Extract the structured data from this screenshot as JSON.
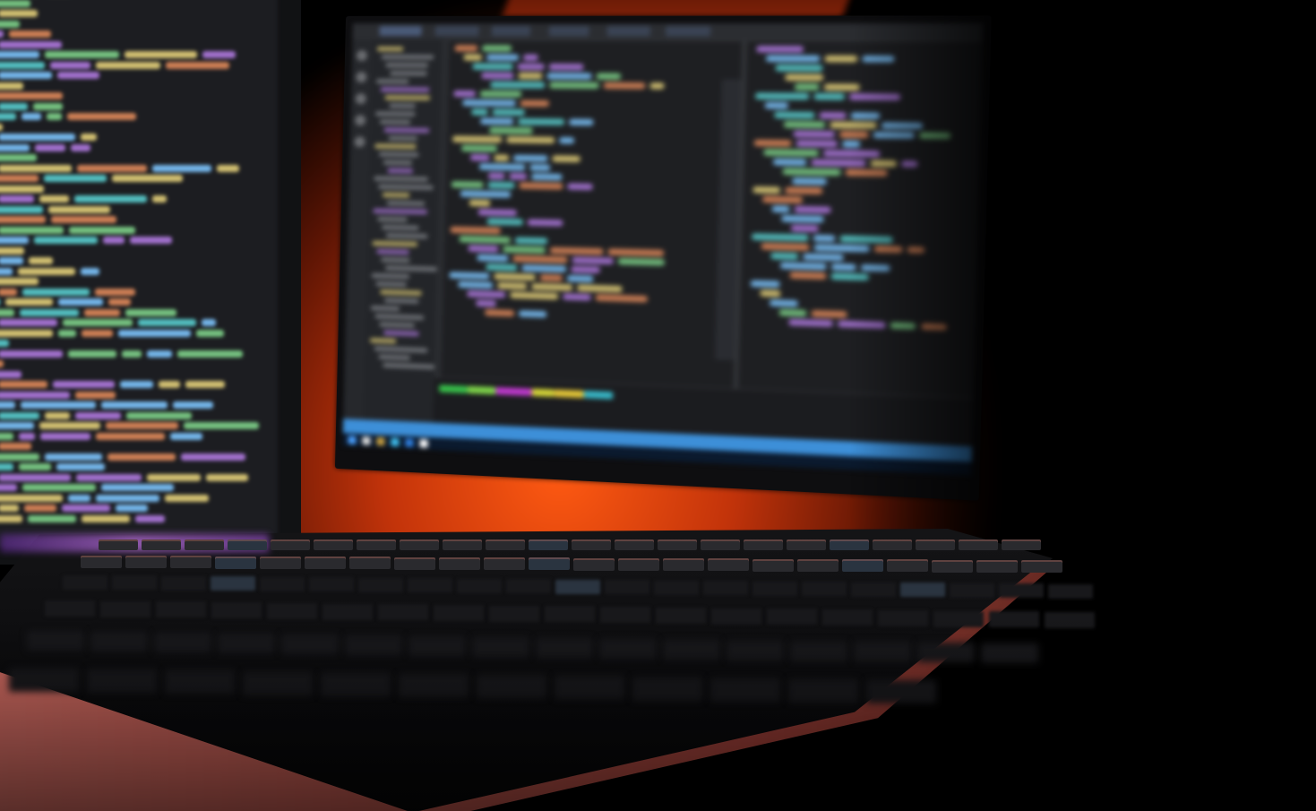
{
  "scene": {
    "description_name": "monitors-with-code-and-keyboard",
    "colors": {
      "wall_glow": "#ff5a12",
      "editor_bg": "#1e1f22",
      "statusbar": "#3d8fd8",
      "keyboard_edge": "#e0746a",
      "code_blue": "#7ec7ff",
      "code_yellow": "#e6d27a",
      "code_purple": "#b07ae0",
      "code_orange": "#e08a5a",
      "code_green": "#7fd48a",
      "code_teal": "#5ad0d0"
    }
  },
  "right_monitor": {
    "icons": [
      "explorer-icon",
      "search-icon",
      "source-control-icon",
      "debug-icon",
      "extensions-icon"
    ],
    "panel_color_bar": [
      "#38c24a",
      "#7fd64a",
      "#c03ad0",
      "#d8d838",
      "#e6c838",
      "#38b8c8"
    ]
  },
  "left_monitor": {},
  "keyboard": {}
}
